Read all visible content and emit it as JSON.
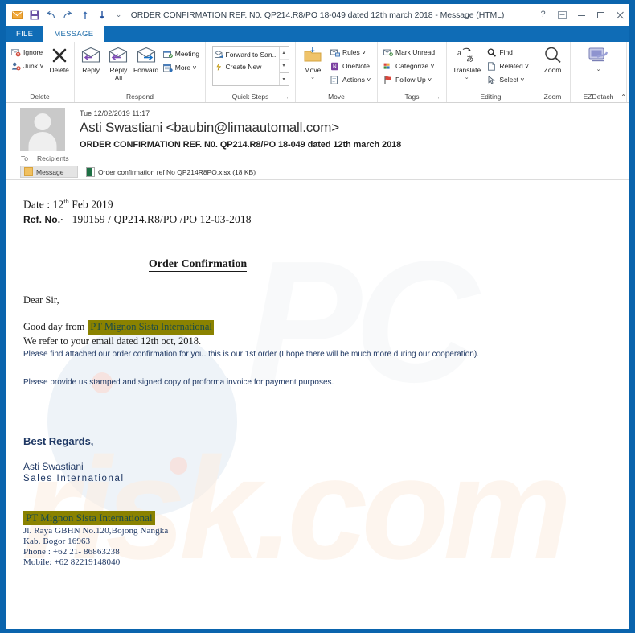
{
  "window": {
    "title": "ORDER CONFIRMATION REF. N0. QP214.R8/PO 18-049 dated 12th march 2018 - Message (HTML)",
    "frame_color": "#0a64ad",
    "quick_access": [
      {
        "name": "mail-icon",
        "glyph": "envelope"
      },
      {
        "name": "save-icon",
        "glyph": "save"
      },
      {
        "name": "undo-icon",
        "glyph": "↺"
      },
      {
        "name": "redo-icon",
        "glyph": "↻"
      },
      {
        "name": "previous-item-icon",
        "glyph": "↑"
      },
      {
        "name": "next-item-icon",
        "glyph": "↓"
      },
      {
        "name": "customize-quick-access-icon",
        "glyph": "⌄"
      }
    ],
    "controls": [
      {
        "name": "help-button",
        "glyph": "?"
      },
      {
        "name": "ribbon-display-options-button",
        "glyph": "▣"
      },
      {
        "name": "minimize-button",
        "glyph": "–"
      },
      {
        "name": "maximize-button",
        "glyph": "▢"
      },
      {
        "name": "close-button",
        "glyph": "✕"
      }
    ]
  },
  "tabs": [
    {
      "label": "FILE",
      "active": false
    },
    {
      "label": "MESSAGE",
      "active": true
    }
  ],
  "ribbon": {
    "collapse_glyph": "⌃",
    "groups": [
      {
        "label": "Delete",
        "small_buttons": [
          {
            "label": "Ignore",
            "icon": "ignore-icon"
          },
          {
            "label": "Junk ˅",
            "icon": "junk-icon"
          }
        ],
        "big_buttons": [
          {
            "label": "Delete",
            "icon": "delete-icon"
          }
        ]
      },
      {
        "label": "Respond",
        "big_buttons": [
          {
            "label": "Reply",
            "icon": "reply-icon"
          },
          {
            "label": "Reply All",
            "icon": "reply-all-icon"
          },
          {
            "label": "Forward",
            "icon": "forward-icon"
          }
        ],
        "small_buttons": [
          {
            "label": "Meeting",
            "icon": "meeting-icon"
          },
          {
            "label": "More ˅",
            "icon": "more-respond-icon"
          }
        ]
      },
      {
        "label": "Quick Steps",
        "dialog_launcher": "⌐",
        "gallery": [
          {
            "label": "Forward to San...",
            "icon": "forward-to-manager-icon"
          },
          {
            "label": "Create New",
            "icon": "create-new-quickstep-icon"
          }
        ],
        "scroll": [
          "▴",
          "▾",
          "▾"
        ]
      },
      {
        "label": "Move",
        "big_buttons": [
          {
            "label": "Move",
            "icon": "move-folder-icon"
          }
        ],
        "small_buttons": [
          {
            "label": "Rules ˅",
            "icon": "rules-icon"
          },
          {
            "label": "OneNote",
            "icon": "onenote-icon"
          },
          {
            "label": "Actions ˅",
            "icon": "actions-icon"
          }
        ]
      },
      {
        "label": "Tags",
        "dialog_launcher": "⌐",
        "small_buttons": [
          {
            "label": "Mark Unread",
            "icon": "mark-unread-icon"
          },
          {
            "label": "Categorize ˅",
            "icon": "categorize-icon"
          },
          {
            "label": "Follow Up ˅",
            "icon": "follow-up-icon"
          }
        ]
      },
      {
        "label": "Editing",
        "big_buttons": [
          {
            "label": "Translate",
            "icon": "translate-icon"
          }
        ],
        "small_buttons": [
          {
            "label": "Find",
            "icon": "find-icon"
          },
          {
            "label": "Related ˅",
            "icon": "related-icon"
          },
          {
            "label": "Select ˅",
            "icon": "select-icon"
          }
        ]
      },
      {
        "label": "Zoom",
        "big_buttons": [
          {
            "label": "Zoom",
            "icon": "zoom-icon"
          }
        ]
      },
      {
        "label": "EZDetach",
        "big_buttons": [
          {
            "label": "",
            "icon": "ezdetach-icon"
          }
        ]
      }
    ]
  },
  "message_header": {
    "date": "Tue 12/02/2019 11:17",
    "from": "Asti Swastiani <baubin@limaautomall.com>",
    "subject": "ORDER CONFIRMATION REF. N0. QP214.R8/PO 18-049 dated 12th march 2018",
    "to_label": "To",
    "to_value": "Recipients"
  },
  "attachments": {
    "message_tab_label": "Message",
    "items": [
      {
        "name": "Order confirmation ref No QP214R8PO.xlsx (18 KB)"
      }
    ]
  },
  "body": {
    "date_label": "Date : 12",
    "date_sup": "th",
    "date_rest": " Feb 2019",
    "ref_label": "Ref. No.·",
    "ref_value": "190159 / QP214.R8/PO /PO 12-03-2018",
    "doc_title": "Order Confirmation",
    "salutation": "Dear Sir,",
    "greeting_prefix": "Good day from",
    "company_highlight": "PT Mignon Sista International",
    "refer_line": "We refer to your email dated 12th oct, 2018.",
    "paragraph_1": "Please find attached our order confirmation for you. this is our 1st order (I hope there will be much more during our cooperation).",
    "paragraph_2": "Please provide us stamped and signed copy of proforma invoice for payment purposes.",
    "closing": "Best Regards,",
    "signer_name": "Asti Swastiani",
    "signer_role": "Sales International",
    "signature_company": "PT Mignon Sista International",
    "address_line_1": "Jl. Raya GBHN No.120,Bojong Nangka",
    "address_line_2": "Kab. Bogor 16963",
    "phone": "Phone : +62 21- 86863238",
    "mobile": "Mobile: +62  82219148040",
    "highlight_bg": "#8a8200",
    "highlight_fg": "#1b4a4a",
    "text_color": "#1f3864",
    "watermark_text": "PCrisk.com"
  }
}
